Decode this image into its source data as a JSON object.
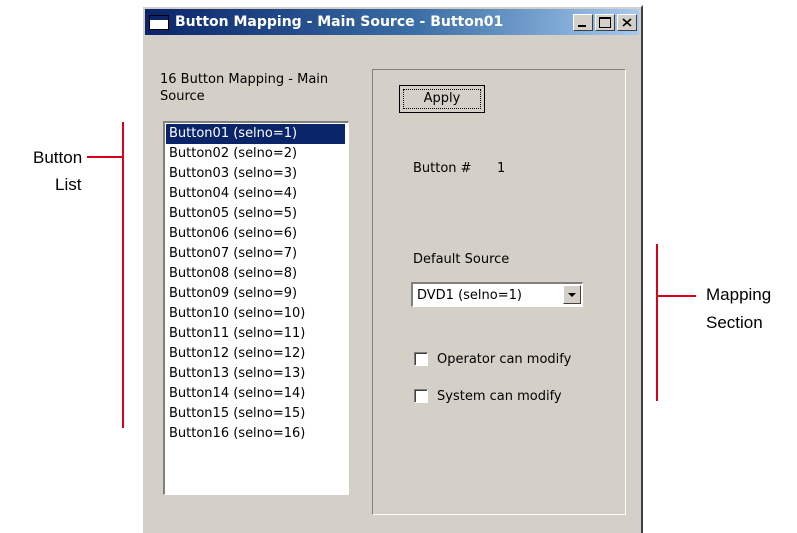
{
  "window": {
    "title": "Button Mapping - Main Source - Button01"
  },
  "button_list": {
    "group_label": "16 Button Mapping - Main Source",
    "items": [
      "Button01 (selno=1)",
      "Button02 (selno=2)",
      "Button03 (selno=3)",
      "Button04 (selno=4)",
      "Button05 (selno=5)",
      "Button06 (selno=6)",
      "Button07 (selno=7)",
      "Button08 (selno=8)",
      "Button09 (selno=9)",
      "Button10 (selno=10)",
      "Button11 (selno=11)",
      "Button12 (selno=12)",
      "Button13 (selno=13)",
      "Button14 (selno=14)",
      "Button15 (selno=15)",
      "Button16 (selno=16)"
    ],
    "selected_index": 0
  },
  "mapping": {
    "apply_label": "Apply",
    "button_number_label": "Button #",
    "button_number_value": "1",
    "default_source_label": "Default Source",
    "default_source_value": "DVD1 (selno=1)",
    "operator_modify_label": "Operator can modify",
    "operator_modify_checked": false,
    "system_modify_label": "System can modify",
    "system_modify_checked": false
  },
  "callouts": {
    "button_list_line1": "Button",
    "button_list_line2": "List",
    "mapping_line1": "Mapping",
    "mapping_line2": "Section"
  },
  "colors": {
    "callout": "#d9001b",
    "selection": "#0a246a",
    "dialog_face": "#d4d0c8"
  }
}
